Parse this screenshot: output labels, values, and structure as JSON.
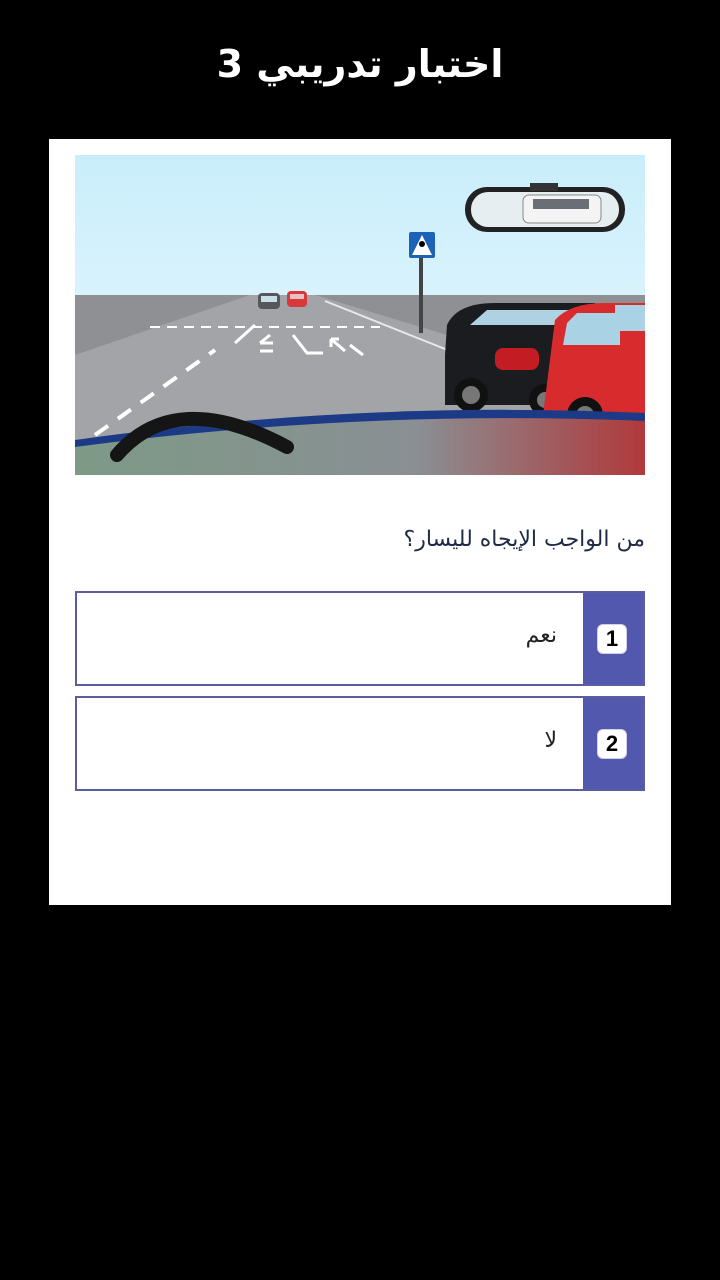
{
  "header": {
    "title": "اختبار تدريبي 3"
  },
  "quiz": {
    "question": "من الواجب الإيجاه لليسار؟",
    "answers": [
      {
        "number": "1",
        "label": "نعم"
      },
      {
        "number": "2",
        "label": "لا"
      }
    ]
  },
  "colors": {
    "background": "#000000",
    "card": "#ffffff",
    "answer_accent": "#5258ad",
    "answer_border": "#5a5e9c"
  }
}
